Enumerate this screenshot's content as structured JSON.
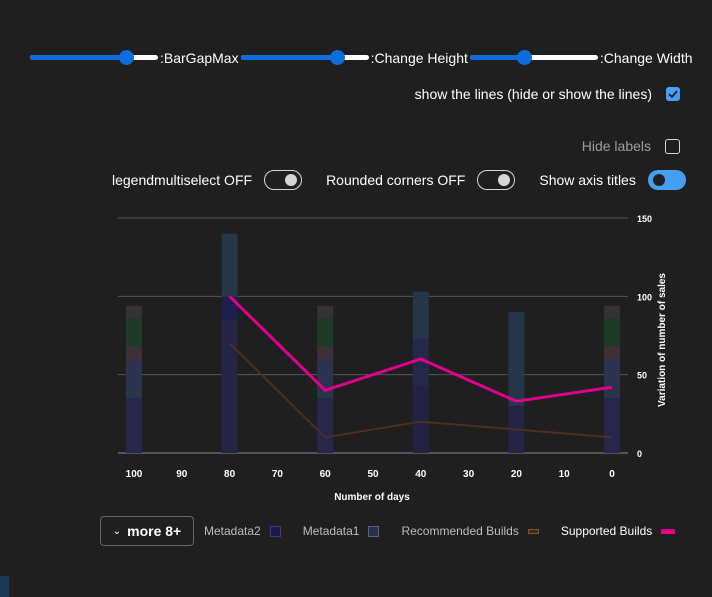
{
  "controls": {
    "sliders": [
      {
        "label": ":BarGapMax",
        "value": 0.75
      },
      {
        "label": ":Change Height",
        "value": 0.75
      },
      {
        "label": ":Change Width",
        "value": 0.42
      }
    ],
    "show_lines": {
      "label": "show the lines (hide or show the lines)",
      "checked": true
    },
    "hide_labels": {
      "label": "Hide labels",
      "checked": false
    },
    "toggles": [
      {
        "label": "legendmultiselect OFF",
        "on": false
      },
      {
        "label": "Rounded corners OFF",
        "on": false
      },
      {
        "label": "Show axis titles",
        "on": true
      }
    ]
  },
  "legend": {
    "more_label": "more 8+",
    "more_icon": "chevron-down-icon",
    "items": [
      {
        "label": "Metadata2",
        "color": "#1a1a4a",
        "border": "#3a3a8a"
      },
      {
        "label": "Metadata1",
        "color": "#2a2f4a",
        "border": "#5a5f8a"
      },
      {
        "label": "Recommended Builds",
        "color": "#3a2a20",
        "border": "#8a5030"
      },
      {
        "label": "Supported Builds",
        "color": "#e3008c",
        "border": "#e3008c"
      }
    ]
  },
  "chart_data": {
    "type": "bar",
    "xlabel": "Number of days",
    "ylabel": "Variation of number of sales",
    "x_ticks": [
      "100",
      "90",
      "80",
      "70",
      "60",
      "50",
      "40",
      "30",
      "20",
      "10",
      "0"
    ],
    "y_ticks": [
      "0",
      "50",
      "100",
      "150"
    ],
    "ylim": [
      0,
      150
    ],
    "xlim": [
      100,
      0
    ],
    "y_axis_position": "right",
    "stacks": [
      {
        "x": 100,
        "segments": [
          {
            "value": 35,
            "color": "#26274a"
          },
          {
            "value": 7,
            "color": "#2a3548"
          },
          {
            "value": 17,
            "color": "#2c3350"
          },
          {
            "value": 9,
            "color": "#3e3038"
          },
          {
            "value": 18,
            "color": "#1f3a26"
          },
          {
            "value": 8,
            "color": "#333333"
          }
        ]
      },
      {
        "x": 80,
        "segments": [
          {
            "value": 85,
            "color": "#242446"
          },
          {
            "value": 15,
            "color": "#1e1e50"
          },
          {
            "value": 40,
            "color": "#243648"
          }
        ]
      },
      {
        "x": 60,
        "segments": [
          {
            "value": 35,
            "color": "#26274a"
          },
          {
            "value": 7,
            "color": "#2a3548"
          },
          {
            "value": 17,
            "color": "#2c3350"
          },
          {
            "value": 9,
            "color": "#3e3038"
          },
          {
            "value": 18,
            "color": "#1f3a26"
          },
          {
            "value": 8,
            "color": "#333333"
          }
        ]
      },
      {
        "x": 40,
        "segments": [
          {
            "value": 43,
            "color": "#222244"
          },
          {
            "value": 30,
            "color": "#26284a"
          },
          {
            "value": 30,
            "color": "#243648"
          }
        ]
      },
      {
        "x": 20,
        "segments": [
          {
            "value": 30,
            "color": "#242446"
          },
          {
            "value": 60,
            "color": "#243648"
          }
        ]
      },
      {
        "x": 0,
        "segments": [
          {
            "value": 35,
            "color": "#26274a"
          },
          {
            "value": 7,
            "color": "#2a3548"
          },
          {
            "value": 17,
            "color": "#2c3350"
          },
          {
            "value": 9,
            "color": "#3e3038"
          },
          {
            "value": 18,
            "color": "#1f3a26"
          },
          {
            "value": 8,
            "color": "#333333"
          }
        ]
      }
    ],
    "series": [
      {
        "name": "Supported Builds",
        "type": "line",
        "color": "#e3008c",
        "x": [
          80,
          60,
          40,
          20,
          0
        ],
        "values": [
          100,
          40,
          60,
          33,
          42
        ]
      },
      {
        "name": "Recommended Builds",
        "type": "line",
        "color": "#4a3020",
        "x": [
          80,
          60,
          40,
          20,
          0
        ],
        "values": [
          70,
          10,
          20,
          15,
          10
        ]
      }
    ],
    "grid": true
  }
}
